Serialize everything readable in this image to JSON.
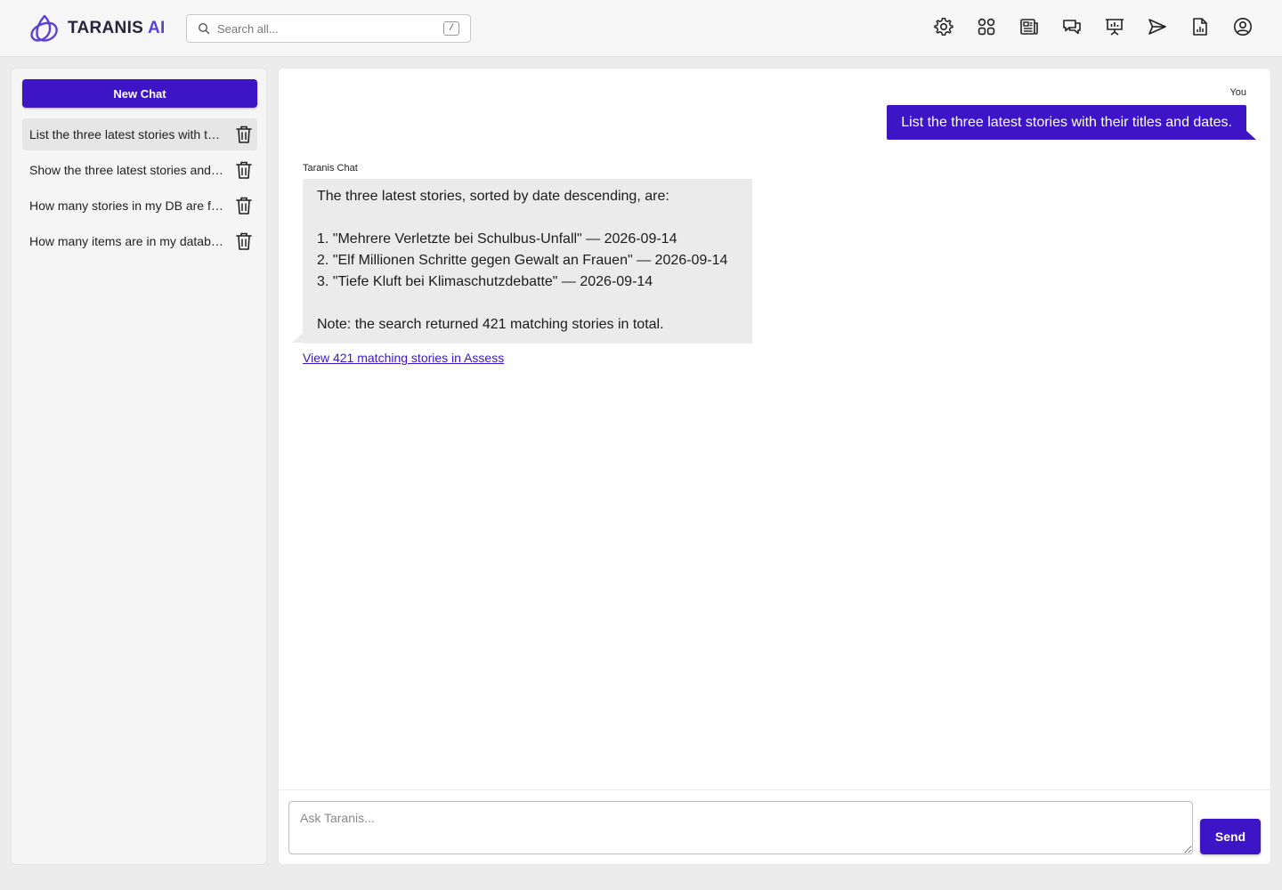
{
  "app": {
    "brand_name": "TARANIS",
    "brand_accent": "AI",
    "brand_color": "#5b3fd6",
    "accent_color": "#3d15c7"
  },
  "header": {
    "search": {
      "placeholder": "Search all...",
      "shortcut": "/"
    },
    "nav_icons": [
      "gear-icon",
      "apps-grid-icon",
      "newspaper-icon",
      "chat-bubbles-icon",
      "presentation-icon",
      "send-icon",
      "report-file-icon",
      "user-account-icon"
    ]
  },
  "sidebar": {
    "new_chat_label": "New Chat",
    "chats": [
      {
        "label": "List the three latest stories with their titles and dates.",
        "active": true
      },
      {
        "label": "Show the three latest stories and their dates.",
        "active": false
      },
      {
        "label": "How many stories in my DB are from this week?",
        "active": false
      },
      {
        "label": "How many items are in my database?",
        "active": false
      }
    ]
  },
  "conversation": {
    "user_label": "You",
    "user_message": "List the three latest stories with their titles and dates.",
    "bot_label": "Taranis Chat",
    "bot_lines": [
      "The three latest stories, sorted by date descending, are:",
      "",
      "1. \"Mehrere Verletzte bei Schulbus-Unfall\" — 2026-09-14",
      "2. \"Elf Millionen Schritte gegen Gewalt an Frauen\" — 2026-09-14",
      "3. \"Tiefe Kluft bei Klimaschutzdebatte\" — 2026-09-14",
      "",
      "Note: the search returned 421 matching stories in total."
    ],
    "link_text": "View 421 matching stories in Assess"
  },
  "composer": {
    "placeholder": "Ask Taranis...",
    "value": "",
    "send_label": "Send"
  }
}
